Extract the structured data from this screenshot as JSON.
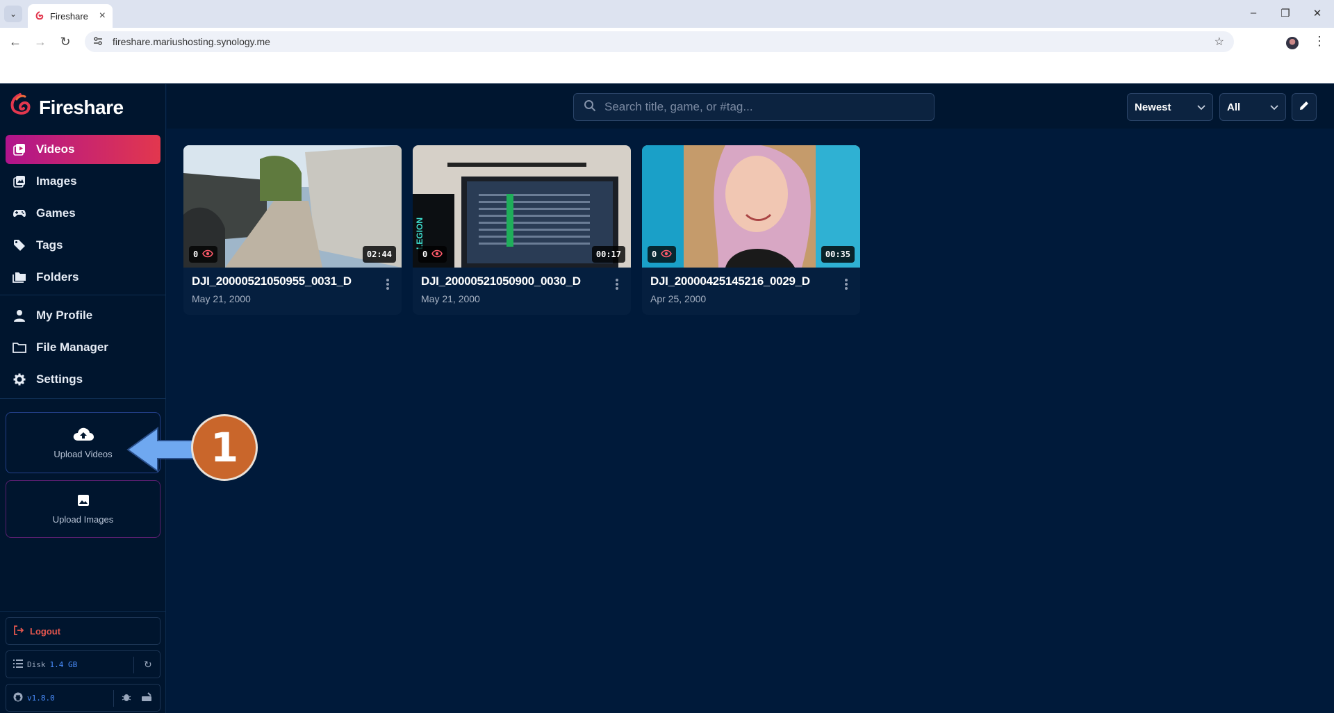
{
  "browser": {
    "tab_title": "Fireshare",
    "url": "fireshare.mariushosting.synology.me"
  },
  "app": {
    "brand": "Fireshare",
    "accent": "#e2374e"
  },
  "sidebar": {
    "items": [
      {
        "label": "Videos",
        "icon": "video-library-icon",
        "active": true
      },
      {
        "label": "Images",
        "icon": "image-library-icon"
      },
      {
        "label": "Games",
        "icon": "gamepad-icon"
      },
      {
        "label": "Tags",
        "icon": "tag-icon"
      },
      {
        "label": "Folders",
        "icon": "folders-icon"
      }
    ],
    "account_items": [
      {
        "label": "My Profile",
        "icon": "person-icon"
      },
      {
        "label": "File Manager",
        "icon": "folder-icon"
      },
      {
        "label": "Settings",
        "icon": "gear-icon"
      }
    ],
    "upload_videos": "Upload Videos",
    "upload_images": "Upload Images",
    "logout": "Logout",
    "disk_label": "Disk",
    "disk_value": "1.4 GB",
    "version": "v1.8.0"
  },
  "toolbar": {
    "search_placeholder": "Search title, game, or #tag...",
    "sort": "Newest",
    "filter": "All"
  },
  "videos": [
    {
      "title": "DJI_20000521050955_0031_D",
      "date": "May 21, 2000",
      "views": "0",
      "duration": "02:44"
    },
    {
      "title": "DJI_20000521050900_0030_D",
      "date": "May 21, 2000",
      "views": "0",
      "duration": "00:17"
    },
    {
      "title": "DJI_20000425145216_0029_D",
      "date": "Apr 25, 2000",
      "views": "0",
      "duration": "00:35"
    }
  ],
  "annotation": {
    "number": "1"
  }
}
